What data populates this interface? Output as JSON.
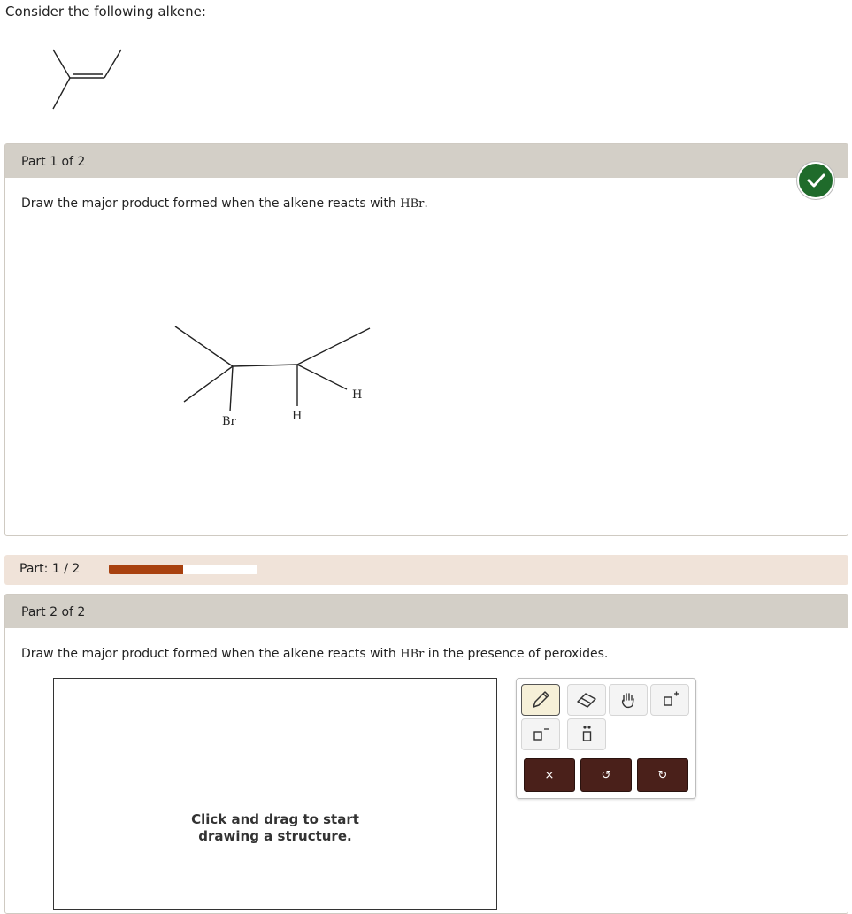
{
  "intro": {
    "text": "Consider the following alkene:"
  },
  "part1": {
    "header": "Part 1 of 2",
    "prompt_prefix": "Draw the major product formed when the alkene reacts with ",
    "reagent": "HBr",
    "prompt_suffix": ".",
    "product_labels": {
      "br": "Br",
      "h_bottom": "H",
      "h_right": "H"
    },
    "status": "correct",
    "status_color": "#1f6b2b"
  },
  "progress": {
    "label": "Part:",
    "current": "1",
    "separator": "/",
    "total": "2",
    "fraction": 0.5,
    "fill_color": "#a8410f"
  },
  "part2": {
    "header": "Part 2 of 2",
    "prompt_prefix": "Draw the major product formed when the alkene reacts with ",
    "reagent": "HBr",
    "prompt_suffix": " in the presence of peroxides.",
    "canvas_hint_line1": "Click and drag to start",
    "canvas_hint_line2": "drawing a structure."
  },
  "toolbox": {
    "tools": [
      "pencil-icon",
      "eraser-icon",
      "hand-icon",
      "add-charge-icon",
      "remove-charge-icon",
      "lone-pair-icon"
    ],
    "actions": [
      "clear-icon",
      "undo-icon",
      "redo-icon"
    ],
    "action_glyphs": {
      "clear": "×",
      "undo": "↺",
      "redo": "↻"
    }
  }
}
